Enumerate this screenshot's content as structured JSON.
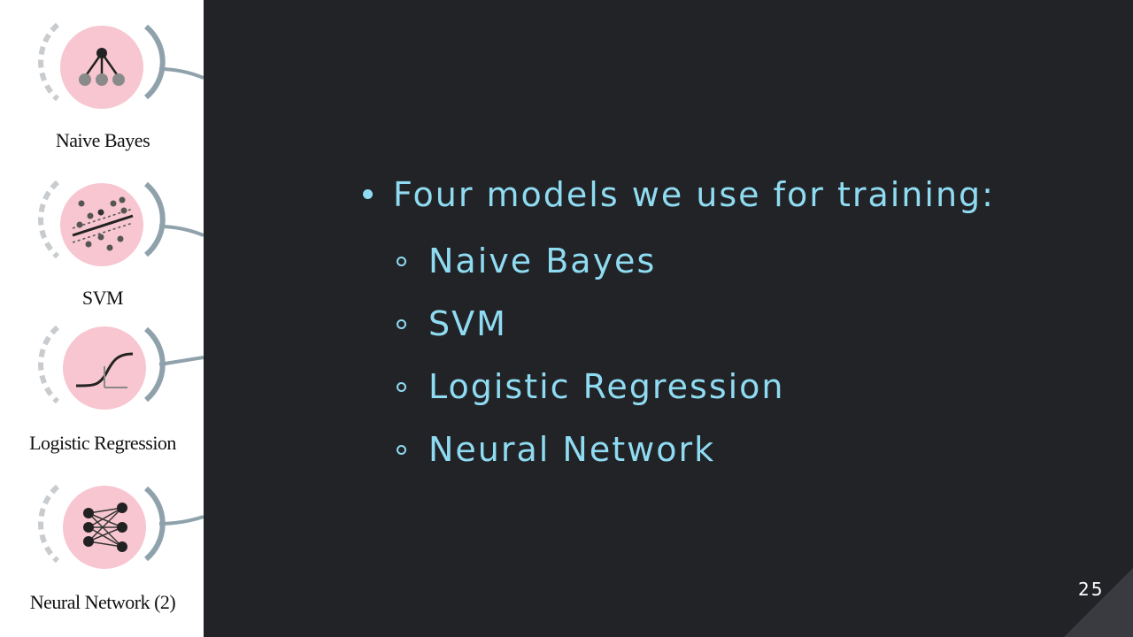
{
  "widgets": [
    {
      "label": "Naive Bayes",
      "icon": "naive-bayes-icon"
    },
    {
      "label": "SVM",
      "icon": "svm-icon"
    },
    {
      "label": "Logistic Regression",
      "icon": "logistic-regression-icon"
    },
    {
      "label": "Neural Network (2)",
      "icon": "neural-network-icon"
    }
  ],
  "slide": {
    "bullet": "Four models we use for training:",
    "sub_bullets": [
      "Naive Bayes",
      "SVM",
      "Logistic Regression",
      "Neural Network"
    ],
    "page_number": "25"
  },
  "colors": {
    "background": "#222327",
    "accent": "#8fdcf2",
    "node_fill": "#f7c6d0",
    "node_arc": "#8fa2ac"
  }
}
